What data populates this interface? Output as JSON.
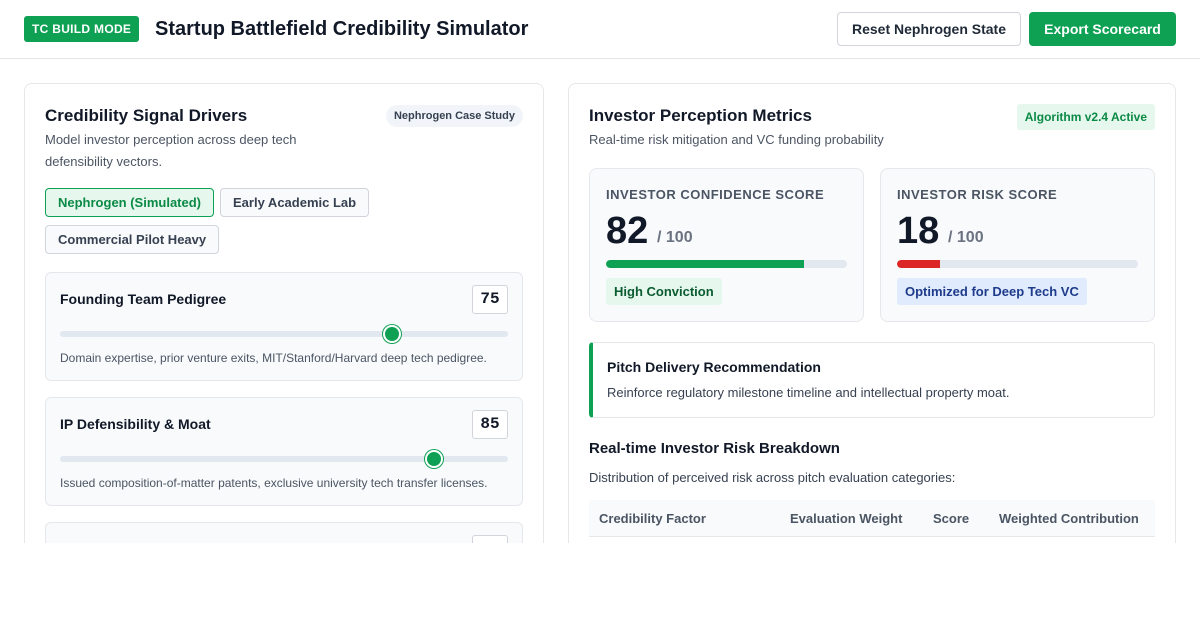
{
  "header": {
    "mode_badge": "TC BUILD MODE",
    "title": "Startup Battlefield Credibility Simulator",
    "reset_label": "Reset Nephrogen State",
    "export_label": "Export Scorecard"
  },
  "left_panel": {
    "title": "Credibility Signal Drivers",
    "subtitle": "Model investor perception across deep tech defensibility vectors.",
    "case_badge": "Nephrogen Case Study",
    "tabs": [
      {
        "label": "Nephrogen (Simulated)",
        "active": true
      },
      {
        "label": "Early Academic Lab",
        "active": false
      },
      {
        "label": "Commercial Pilot Heavy",
        "active": false
      }
    ],
    "drivers": [
      {
        "name": "Founding Team Pedigree",
        "value": "75",
        "description": "Domain expertise, prior venture exits, MIT/Stanford/Harvard deep tech pedigree."
      },
      {
        "name": "IP Defensibility & Moat",
        "value": "85",
        "description": "Issued composition-of-matter patents, exclusive university tech transfer licenses."
      },
      {
        "name": "",
        "value": "",
        "description": ""
      }
    ]
  },
  "right_panel": {
    "title": "Investor Perception Metrics",
    "subtitle": "Real-time risk mitigation and VC funding probability",
    "algo_badge": "Algorithm v2.4 Active",
    "confidence": {
      "label": "INVESTOR CONFIDENCE SCORE",
      "score": "82",
      "max": "/ 100",
      "level": 0.82,
      "color": "#0ea154",
      "badge": "High Conviction"
    },
    "risk": {
      "label": "INVESTOR RISK SCORE",
      "score": "18",
      "max": "/ 100",
      "level": 0.18,
      "color": "#dc2626",
      "badge": "Optimized for Deep Tech VC"
    },
    "recommendation": {
      "title": "Pitch Delivery Recommendation",
      "text": "Reinforce regulatory milestone timeline and intellectual property moat."
    },
    "breakdown": {
      "title": "Real-time Investor Risk Breakdown",
      "description": "Distribution of perceived risk across pitch evaluation categories:",
      "columns": [
        "Credibility Factor",
        "Evaluation Weight",
        "Score",
        "Weighted Contribution"
      ]
    }
  },
  "colors": {
    "accent": "#0ea154",
    "risk": "#dc2626"
  }
}
